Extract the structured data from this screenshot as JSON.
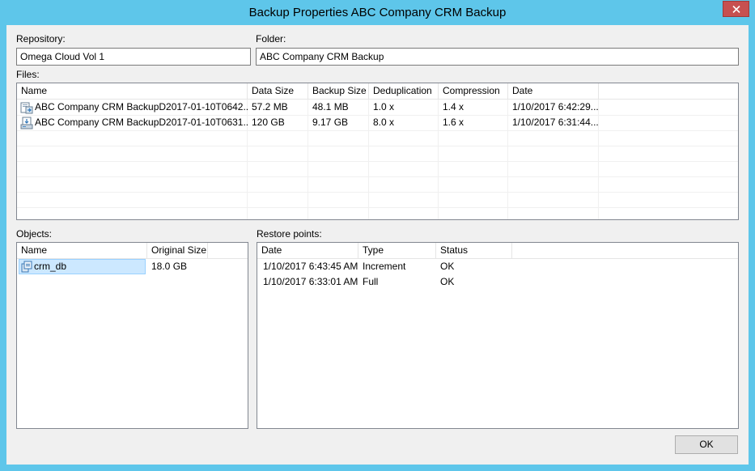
{
  "window": {
    "title": "Backup Properties ABC Company CRM Backup"
  },
  "repository": {
    "label": "Repository:",
    "value": "Omega Cloud Vol 1"
  },
  "folder": {
    "label": "Folder:",
    "value": "ABC Company CRM Backup"
  },
  "files": {
    "label": "Files:",
    "columns": [
      "Name",
      "Data Size",
      "Backup Size",
      "Deduplication",
      "Compression",
      "Date"
    ],
    "rows": [
      {
        "icon": "incremental-backup-file-icon",
        "name": "ABC Company CRM BackupD2017-01-10T0642...",
        "data_size": "57.2 MB",
        "backup_size": "48.1 MB",
        "deduplication": "1.0 x",
        "compression": "1.4 x",
        "date": "1/10/2017 6:42:29..."
      },
      {
        "icon": "full-backup-file-icon",
        "name": "ABC Company CRM BackupD2017-01-10T0631...",
        "data_size": "120 GB",
        "backup_size": "9.17 GB",
        "deduplication": "8.0 x",
        "compression": "1.6 x",
        "date": "1/10/2017 6:31:44..."
      }
    ]
  },
  "objects": {
    "label": "Objects:",
    "columns": [
      "Name",
      "Original Size"
    ],
    "rows": [
      {
        "icon": "database-icon",
        "name": "crm_db",
        "original_size": "18.0 GB"
      }
    ]
  },
  "restore_points": {
    "label": "Restore points:",
    "columns": [
      "Date",
      "Type",
      "Status"
    ],
    "rows": [
      {
        "date": "1/10/2017 6:43:45 AM",
        "type": "Increment",
        "status": "OK"
      },
      {
        "date": "1/10/2017 6:33:01 AM",
        "type": "Full",
        "status": "OK"
      }
    ]
  },
  "buttons": {
    "ok": "OK"
  },
  "colors": {
    "title_bar": "#5ec6ea",
    "close_button": "#c75050",
    "selection": "#cce8ff"
  }
}
